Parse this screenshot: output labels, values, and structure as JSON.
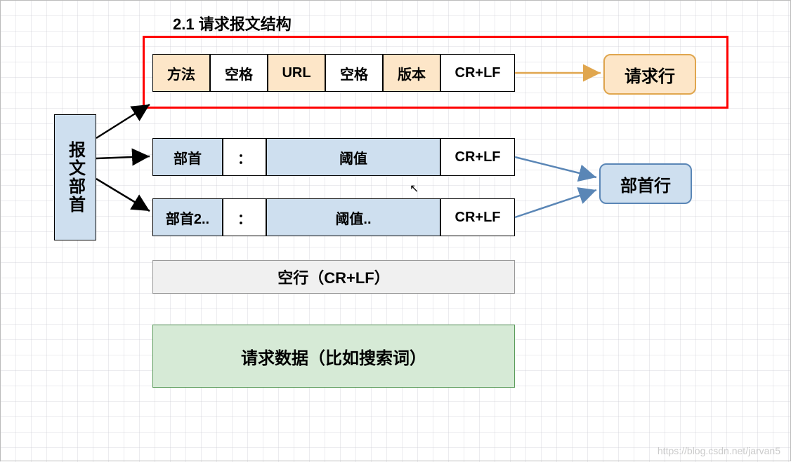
{
  "title": "2.1 请求报文结构",
  "sideLabel": "报文部首",
  "row1": {
    "method": "方法",
    "sp1": "空格",
    "url": "URL",
    "sp2": "空格",
    "ver": "版本",
    "crlf": "CR+LF",
    "badge": "请求行"
  },
  "row2": {
    "hdr": "部首",
    "colon": "：",
    "val": "阈值",
    "crlf": "CR+LF"
  },
  "row3": {
    "hdr": "部首2..",
    "colon": "：",
    "val": "阈值..",
    "crlf": "CR+LF"
  },
  "headerBadge": "部首行",
  "blankLine": "空行（CR+LF）",
  "body": "请求数据（比如搜索词）",
  "watermark": "https://blog.csdn.net/jarvan5"
}
